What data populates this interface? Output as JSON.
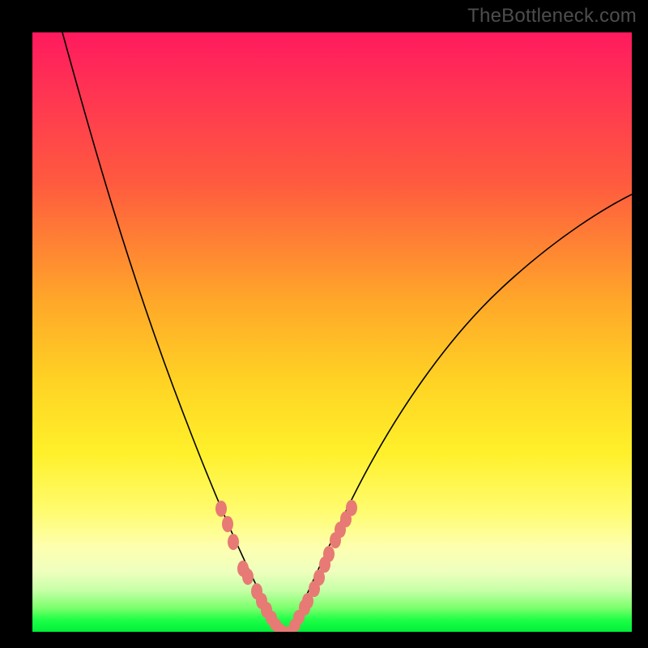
{
  "watermark": "TheBottleneck.com",
  "chart_data": {
    "type": "line",
    "title": "",
    "xlabel": "",
    "ylabel": "",
    "xlim": [
      0,
      100
    ],
    "ylim": [
      0,
      100
    ],
    "legend": false,
    "grid": false,
    "left_curve": {
      "description": "Steep descending curve from top-left toward bottom-center",
      "x": [
        5,
        8,
        12,
        16,
        20,
        24,
        27,
        30,
        32,
        34,
        36,
        38,
        39,
        40,
        41
      ],
      "y": [
        100,
        88,
        74,
        60,
        47,
        36,
        28,
        21,
        16,
        11,
        8,
        5,
        3,
        1,
        0
      ]
    },
    "right_curve": {
      "description": "Ascending saturating curve from bottom-center toward upper-right",
      "x": [
        43,
        45,
        47,
        50,
        53,
        57,
        62,
        68,
        74,
        80,
        86,
        92,
        98,
        100
      ],
      "y": [
        0,
        3,
        7,
        13,
        20,
        28,
        37,
        46,
        53,
        59,
        64,
        68,
        72,
        73
      ]
    },
    "bottom_flat": {
      "x": [
        41,
        42,
        43
      ],
      "y": [
        0,
        0,
        0
      ]
    },
    "series": [
      {
        "name": "left-dots",
        "type": "scatter",
        "color": "#e77a74",
        "x": [
          31.5,
          32.5,
          33.5,
          35.2,
          36.0,
          37.4,
          38.2,
          39.0,
          39.8,
          40.5,
          41.2,
          42.0
        ],
        "y": [
          20.5,
          18.0,
          15.0,
          10.5,
          9.3,
          6.8,
          5.2,
          3.6,
          2.3,
          1.2,
          0.5,
          0.1
        ]
      },
      {
        "name": "right-dots",
        "type": "scatter",
        "color": "#e77a74",
        "x": [
          43.0,
          43.8,
          44.5,
          45.4,
          46.0,
          47.0,
          47.8,
          48.8,
          49.5,
          50.6,
          51.4,
          52.3,
          53.2
        ],
        "y": [
          0.2,
          1.1,
          2.4,
          4.0,
          5.2,
          7.2,
          9.0,
          11.2,
          13.0,
          15.2,
          17.0,
          18.8,
          20.6
        ]
      }
    ],
    "background_gradient": {
      "top": "#ff1a5e",
      "mid1": "#ffa829",
      "mid2": "#fff02a",
      "bottom": "#00ef3a"
    }
  }
}
